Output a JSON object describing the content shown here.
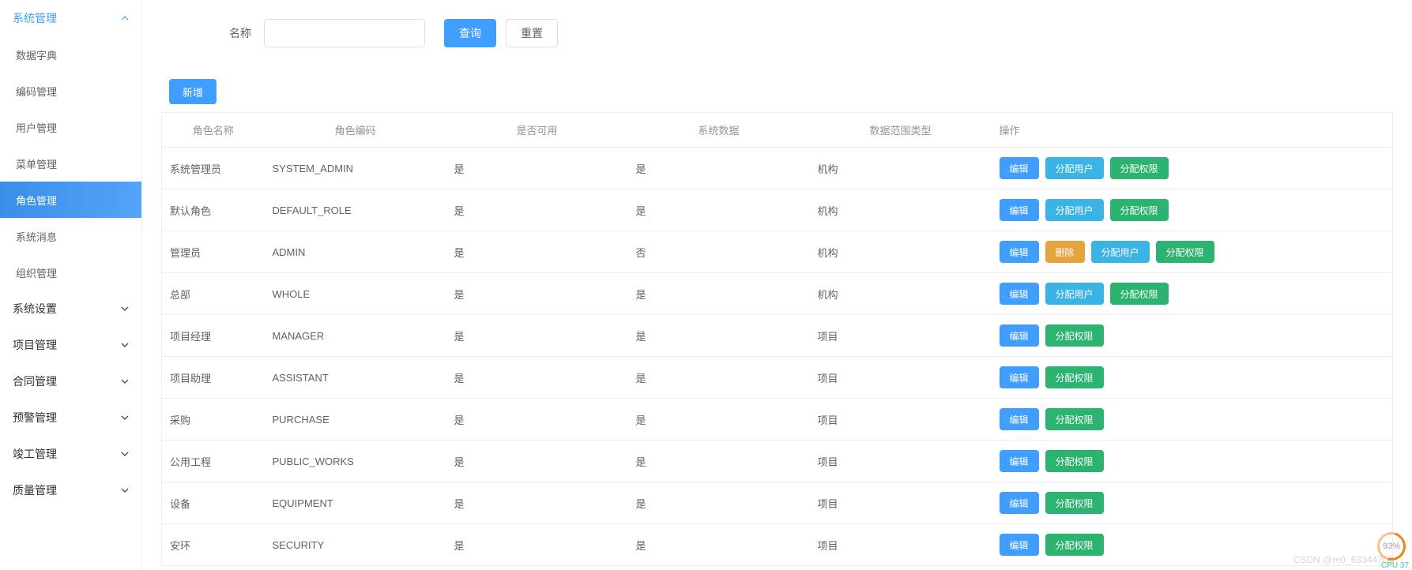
{
  "sidebar": {
    "groups": [
      {
        "label": "系统管理",
        "expanded": true,
        "active": true,
        "items": [
          {
            "label": "数据字典"
          },
          {
            "label": "编码管理"
          },
          {
            "label": "用户管理"
          },
          {
            "label": "菜单管理"
          },
          {
            "label": "角色管理",
            "selected": true
          },
          {
            "label": "系统消息"
          },
          {
            "label": "组织管理"
          }
        ]
      },
      {
        "label": "系统设置",
        "expanded": false
      },
      {
        "label": "项目管理",
        "expanded": false
      },
      {
        "label": "合同管理",
        "expanded": false
      },
      {
        "label": "预警管理",
        "expanded": false
      },
      {
        "label": "竣工管理",
        "expanded": false
      },
      {
        "label": "质量管理",
        "expanded": false
      }
    ]
  },
  "search": {
    "label": "名称",
    "value": "",
    "query_btn": "查询",
    "reset_btn": "重置"
  },
  "toolbar": {
    "add_btn": "新增"
  },
  "table": {
    "headers": [
      "角色名称",
      "角色编码",
      "是否可用",
      "系统数据",
      "数据范围类型",
      "操作"
    ],
    "action_labels": {
      "edit": "编辑",
      "delete": "删除",
      "assign_user": "分配用户",
      "assign_perm": "分配权限"
    },
    "rows": [
      {
        "name": "系统管理员",
        "code": "SYSTEM_ADMIN",
        "enabled": "是",
        "sys": "是",
        "scope": "机构",
        "actions": [
          "edit",
          "assign_user",
          "assign_perm"
        ]
      },
      {
        "name": "默认角色",
        "code": "DEFAULT_ROLE",
        "enabled": "是",
        "sys": "是",
        "scope": "机构",
        "actions": [
          "edit",
          "assign_user",
          "assign_perm"
        ]
      },
      {
        "name": "管理员",
        "code": "ADMIN",
        "enabled": "是",
        "sys": "否",
        "scope": "机构",
        "actions": [
          "edit",
          "delete",
          "assign_user",
          "assign_perm"
        ]
      },
      {
        "name": "总部",
        "code": "WHOLE",
        "enabled": "是",
        "sys": "是",
        "scope": "机构",
        "actions": [
          "edit",
          "assign_user",
          "assign_perm"
        ]
      },
      {
        "name": "项目经理",
        "code": "MANAGER",
        "enabled": "是",
        "sys": "是",
        "scope": "项目",
        "actions": [
          "edit",
          "assign_perm"
        ]
      },
      {
        "name": "项目助理",
        "code": "ASSISTANT",
        "enabled": "是",
        "sys": "是",
        "scope": "项目",
        "actions": [
          "edit",
          "assign_perm"
        ]
      },
      {
        "name": "采购",
        "code": "PURCHASE",
        "enabled": "是",
        "sys": "是",
        "scope": "项目",
        "actions": [
          "edit",
          "assign_perm"
        ]
      },
      {
        "name": "公用工程",
        "code": "PUBLIC_WORKS",
        "enabled": "是",
        "sys": "是",
        "scope": "项目",
        "actions": [
          "edit",
          "assign_perm"
        ]
      },
      {
        "name": "设备",
        "code": "EQUIPMENT",
        "enabled": "是",
        "sys": "是",
        "scope": "项目",
        "actions": [
          "edit",
          "assign_perm"
        ]
      },
      {
        "name": "安环",
        "code": "SECURITY",
        "enabled": "是",
        "sys": "是",
        "scope": "项目",
        "actions": [
          "edit",
          "assign_perm"
        ]
      }
    ]
  },
  "watermark": "CSDN @m0_63344708",
  "cpu": {
    "pct": "93%",
    "label": "CPU 37",
    "top": "0.07"
  }
}
